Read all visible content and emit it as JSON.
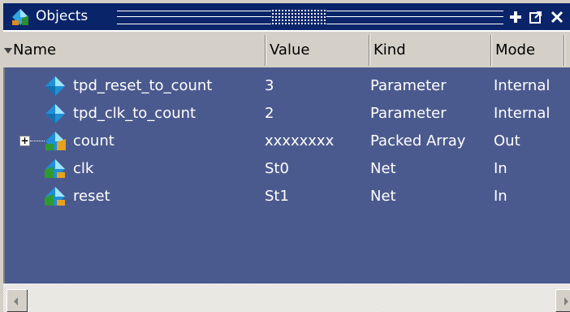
{
  "window": {
    "title": "Objects",
    "icons": {
      "app": "objects-icon",
      "add": "add-icon",
      "undock": "undock-icon",
      "close": "close-icon"
    },
    "colors": {
      "titlebar": "#0a246a",
      "list_background": "#4b5a8e",
      "text": "#ffffff"
    }
  },
  "columns": {
    "name": "Name",
    "value": "Value",
    "kind": "Kind",
    "mode": "Mode"
  },
  "rows": [
    {
      "name": "tpd_reset_to_count",
      "value": "3",
      "kind": "Parameter",
      "mode": "Internal",
      "icon": "parameter-icon",
      "expandable": false
    },
    {
      "name": "tpd_clk_to_count",
      "value": "2",
      "kind": "Parameter",
      "mode": "Internal",
      "icon": "parameter-icon",
      "expandable": false
    },
    {
      "name": "count",
      "value": "xxxxxxxx",
      "kind": "Packed Array",
      "mode": "Out",
      "icon": "signal-out-icon",
      "expandable": true
    },
    {
      "name": "clk",
      "value": "St0",
      "kind": "Net",
      "mode": "In",
      "icon": "signal-in-icon",
      "expandable": false
    },
    {
      "name": "reset",
      "value": "St1",
      "kind": "Net",
      "mode": "In",
      "icon": "signal-in-icon",
      "expandable": false
    }
  ],
  "expander_glyph": "+"
}
